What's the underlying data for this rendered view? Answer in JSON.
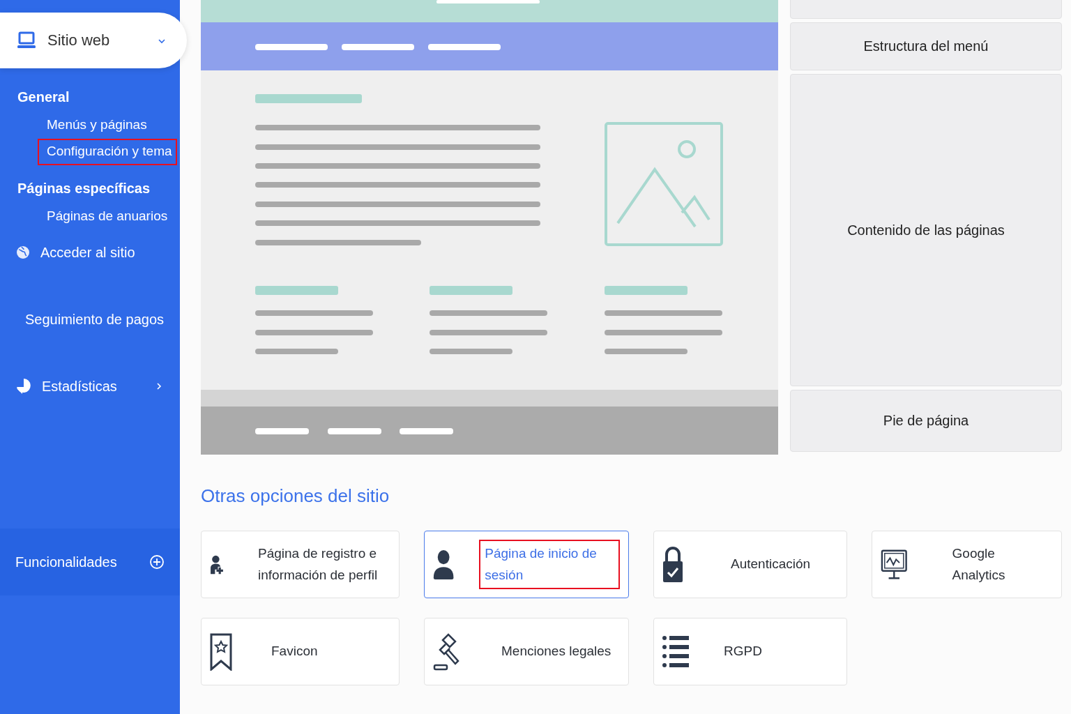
{
  "sidebar": {
    "header": {
      "label": "Sitio web"
    },
    "sections": [
      {
        "title": "General",
        "items": [
          {
            "label": "Menús y páginas",
            "selected": false
          },
          {
            "label": "Configuración y tema",
            "selected": true
          }
        ]
      },
      {
        "title": "Páginas específicas",
        "items": [
          {
            "label": "Páginas de anuarios",
            "selected": false
          }
        ]
      }
    ],
    "nav": [
      {
        "label": "Acceder al sitio",
        "expandable": false
      },
      {
        "label": "Seguimiento de pagos",
        "expandable": false
      },
      {
        "label": "Estadísticas",
        "expandable": true
      }
    ],
    "footer": {
      "label": "Funcionalidades"
    }
  },
  "layout_sections": [
    {
      "label": "Estructura del menú"
    },
    {
      "label": "Contenido de las páginas"
    },
    {
      "label": "Pie de página"
    }
  ],
  "other_options": {
    "title": "Otras opciones del sitio",
    "cards": [
      {
        "label": "Página de registro e información de perfil",
        "selected": false
      },
      {
        "label": "Página de inicio de sesión",
        "selected": true
      },
      {
        "label": "Autenticación",
        "selected": false
      },
      {
        "label": "Google Analytics",
        "selected": false
      },
      {
        "label": "Favicon",
        "selected": false
      },
      {
        "label": "Menciones legales",
        "selected": false
      },
      {
        "label": "RGPD",
        "selected": false
      }
    ]
  }
}
